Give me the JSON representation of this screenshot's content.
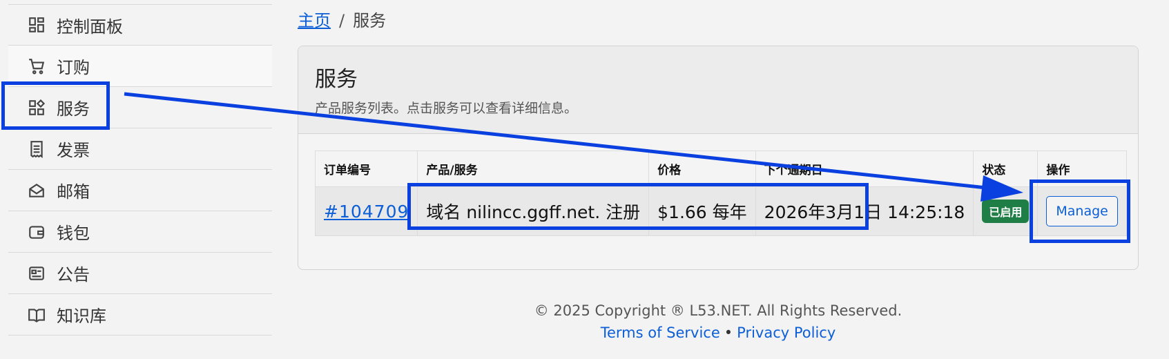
{
  "sidebar": {
    "items": [
      {
        "label": "控制面板",
        "icon": "dashboard-icon"
      },
      {
        "label": "订购",
        "icon": "cart-icon"
      },
      {
        "label": "服务",
        "icon": "services-icon"
      },
      {
        "label": "发票",
        "icon": "invoice-icon"
      },
      {
        "label": "邮箱",
        "icon": "mail-icon"
      },
      {
        "label": "钱包",
        "icon": "wallet-icon"
      },
      {
        "label": "公告",
        "icon": "news-icon"
      },
      {
        "label": "知识库",
        "icon": "book-icon"
      }
    ]
  },
  "breadcrumb": {
    "home": "主页",
    "separator": "/",
    "current": "服务"
  },
  "card": {
    "title": "服务",
    "subtitle": "产品服务列表。点击服务可以查看详细信息。"
  },
  "table": {
    "headers": [
      "订单编号",
      "产品/服务",
      "价格",
      "下个通期日",
      "状态",
      "操作"
    ],
    "rows": [
      {
        "order_id": "#104709",
        "product": "域名 nilincc.ggff.net. 注册",
        "price": "$1.66 每年",
        "next_due": "2026年3月1日 14:25:18",
        "status": "已启用",
        "action": "Manage"
      }
    ]
  },
  "footer": {
    "copyright": "© 2025 Copyright ® L53.NET. All Rights Reserved.",
    "terms": "Terms of Service",
    "bullet": "•",
    "privacy": "Privacy Policy"
  },
  "colors": {
    "accent": "#0b5ed7",
    "annotation": "#0a3fe0",
    "status_active": "#1e7e45"
  }
}
